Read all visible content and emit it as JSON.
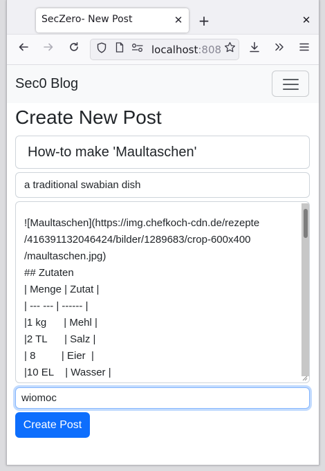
{
  "browser": {
    "tab_title": "SecZero- New Post",
    "tab_close": "✕",
    "new_tab": "+",
    "window_close": "✕",
    "url_host": "localhost",
    "url_port_partial": ":808",
    "icons": {
      "back": "back-arrow-icon",
      "forward": "forward-arrow-icon",
      "reload": "reload-icon",
      "shield": "shield-icon",
      "page": "page-icon",
      "permissions": "permissions-icon",
      "star": "bookmark-star-icon",
      "download": "download-icon",
      "overflow": "chevrons-right-icon",
      "menu": "hamburger-menu-icon"
    }
  },
  "app": {
    "brand": "Sec0 Blog",
    "page_title": "Create New Post"
  },
  "form": {
    "title_value": "How-to make 'Maultaschen'",
    "subtitle_value": "a traditional swabian dish",
    "body_lines": [
      "![Maultaschen](https://img.chefkoch-cdn.de/rezepte",
      "/416391132046424/bilder/1289683/crop-600x400",
      "/maultaschen.jpg)",
      "## Zutaten",
      "| Menge | Zutat |",
      "| --- --- | ------ |",
      "|1 kg      | Mehl |",
      "|2 TL      | Salz |",
      "| 8         | Eier  |",
      "|10 EL    | Wasser |"
    ],
    "tags_value": "wiomoc",
    "submit_label": "Create Post"
  },
  "colors": {
    "primary": "#0d6efd",
    "navbar_bg": "#f8f9fa",
    "text": "#212529"
  }
}
